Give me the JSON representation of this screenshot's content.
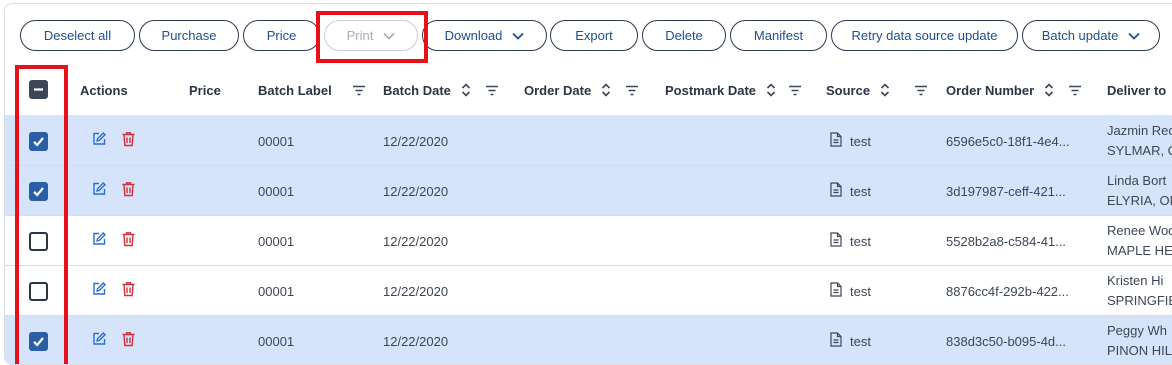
{
  "toolbar": {
    "deselect_all": "Deselect all",
    "purchase": "Purchase",
    "price": "Price",
    "print": "Print",
    "download": "Download",
    "export": "Export",
    "delete": "Delete",
    "manifest": "Manifest",
    "retry": "Retry data source update",
    "batch_update": "Batch update"
  },
  "columns": {
    "actions": "Actions",
    "price": "Price",
    "batch_label": "Batch Label",
    "batch_date": "Batch Date",
    "order_date": "Order Date",
    "postmark_date": "Postmark Date",
    "source": "Source",
    "order_number": "Order Number",
    "deliver_to": "Deliver to"
  },
  "rows": [
    {
      "checked": true,
      "batch_label": "00001",
      "batch_date": "12/22/2020",
      "source": "test",
      "order_number": "6596e5c0-18f1-4e4...",
      "deliver_name": "Jazmin Rec",
      "deliver_city": "SYLMAR, C"
    },
    {
      "checked": true,
      "batch_label": "00001",
      "batch_date": "12/22/2020",
      "source": "test",
      "order_number": "3d197987-ceff-421...",
      "deliver_name": "Linda Bort",
      "deliver_city": "ELYRIA, OH"
    },
    {
      "checked": false,
      "batch_label": "00001",
      "batch_date": "12/22/2020",
      "source": "test",
      "order_number": "5528b2a8-c584-41...",
      "deliver_name": "Renee Woo",
      "deliver_city": "MAPLE HE"
    },
    {
      "checked": false,
      "batch_label": "00001",
      "batch_date": "12/22/2020",
      "source": "test",
      "order_number": "8876cc4f-292b-422...",
      "deliver_name": "Kristen Hi",
      "deliver_city": "SPRINGFIE"
    },
    {
      "checked": true,
      "batch_label": "00001",
      "batch_date": "12/22/2020",
      "source": "test",
      "order_number": "838d3c50-b095-4d...",
      "deliver_name": "Peggy Wh",
      "deliver_city": "PINON HIL"
    }
  ],
  "colors": {
    "selected_row": "#d6e4fb",
    "checkbox_checked": "#2a5ea5",
    "button_text": "#1e4f8c",
    "edit_icon": "#2a6fd1",
    "delete_icon": "#d0303a",
    "highlight_box": "#e3121b"
  }
}
